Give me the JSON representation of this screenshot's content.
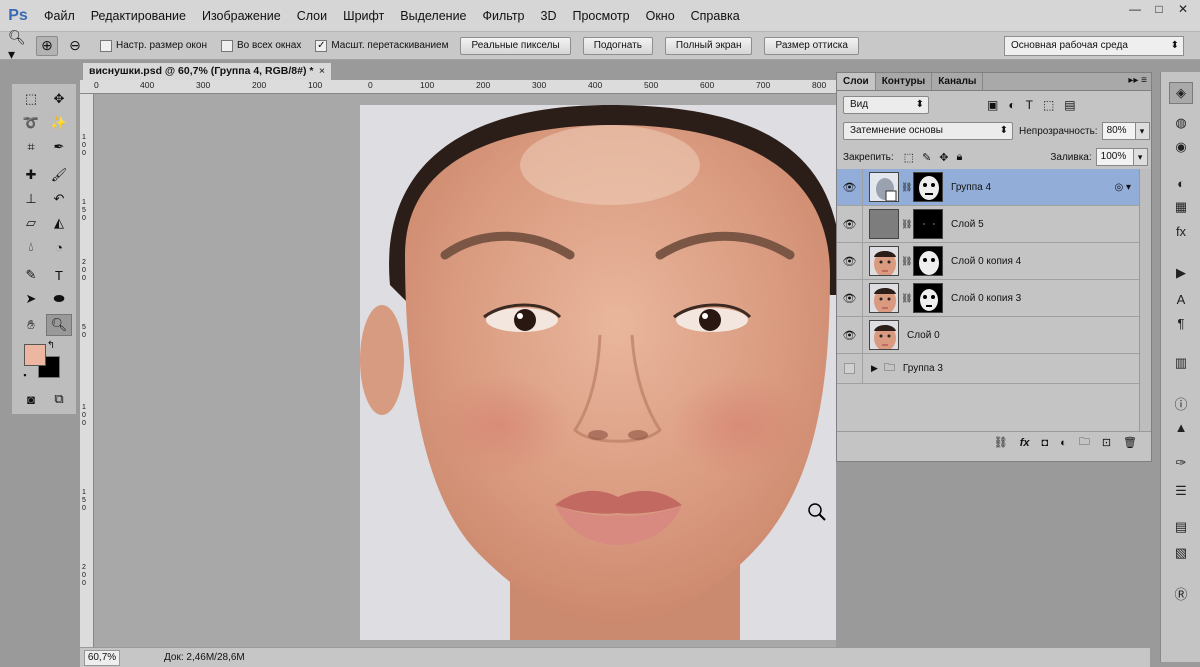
{
  "app": {
    "logo": "Ps"
  },
  "menu": [
    "Файл",
    "Редактирование",
    "Изображение",
    "Слои",
    "Шрифт",
    "Выделение",
    "Фильтр",
    "3D",
    "Просмотр",
    "Окно",
    "Справка"
  ],
  "window_controls": {
    "minimize": "—",
    "maximize": "□",
    "close": "✕"
  },
  "options": {
    "resize_windows": "Настр. размер окон",
    "all_windows": "Во всех окнах",
    "scrubby_zoom": "Масшт. перетаскиванием",
    "scrubby_checked": "✓",
    "actual_pixels": "Реальные пикселы",
    "fit_screen": "Подогнать",
    "fill_screen": "Полный экран",
    "print_size": "Размер оттиска",
    "workspace": "Основная рабочая среда"
  },
  "document": {
    "tab_title": "виснушки.psd @ 60,7% (Группа 4, RGB/8#) *",
    "tab_close": "×",
    "ruler_labels": [
      "0",
      "400",
      "300",
      "200",
      "100",
      "0",
      "100",
      "200",
      "300",
      "400",
      "500",
      "600",
      "700",
      "800"
    ],
    "vruler_labels": [
      "1 0 0",
      "1 5 0",
      "2 0 0",
      "5 0",
      "1 0 0",
      "1 5 0",
      "2 0 0"
    ]
  },
  "status": {
    "zoom": "60,7%",
    "doc_size": "Док: 2,46M/28,6M"
  },
  "layers_panel": {
    "tabs": [
      "Слои",
      "Контуры",
      "Каналы"
    ],
    "menu_icon": "▸▸ ≡",
    "filter_kind": "Вид",
    "blend_mode": "Затемнение основы",
    "opacity_label": "Непрозрачность:",
    "opacity_value": "80%",
    "lock_label": "Закрепить:",
    "fill_label": "Заливка:",
    "fill_value": "100%",
    "layers": [
      {
        "name": "Группа 4",
        "selected": true,
        "visible": true
      },
      {
        "name": "Слой 5",
        "selected": false,
        "visible": true
      },
      {
        "name": "Слой 0 копия 4",
        "selected": false,
        "visible": true
      },
      {
        "name": "Слой 0 копия 3",
        "selected": false,
        "visible": true
      },
      {
        "name": "Слой 0",
        "selected": false,
        "visible": true
      },
      {
        "name": "Группа 3",
        "selected": false,
        "visible": false
      }
    ]
  },
  "colors": {
    "foreground": "#ecb6a0",
    "background": "#000000",
    "selection": "#92aed8"
  }
}
